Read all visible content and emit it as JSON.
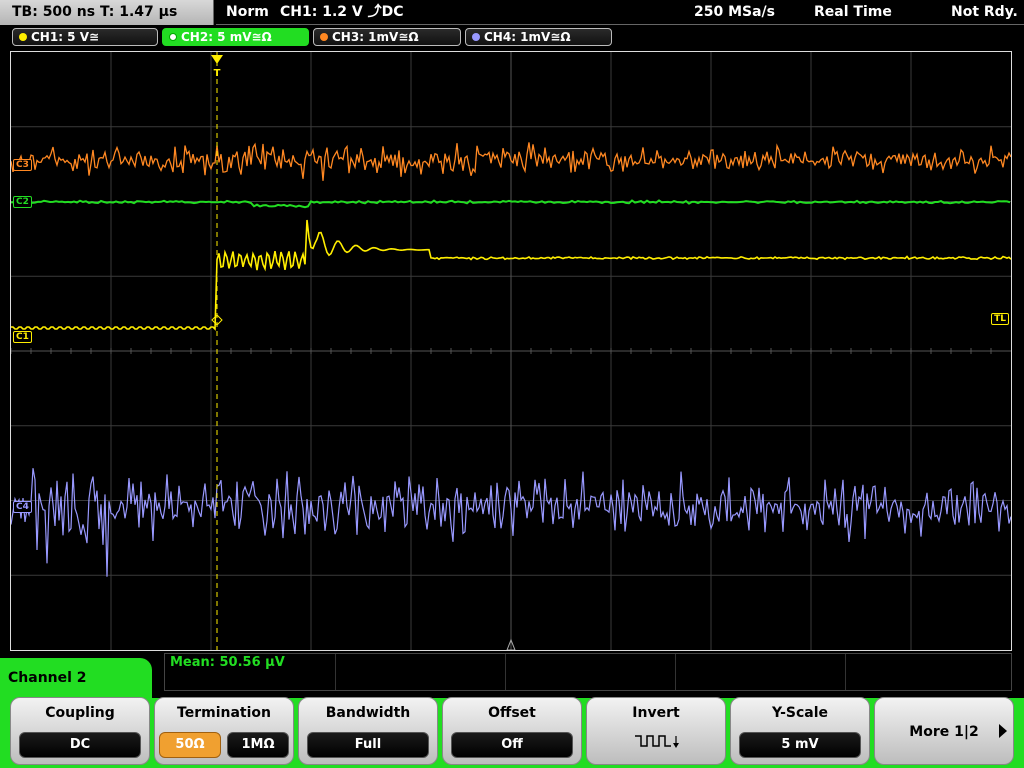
{
  "status_bar": {
    "timebase": "TB: 500 ns   T: 1.47 µs",
    "mode": "Norm",
    "trigger": "CH1: 1.2 V ⤴DC",
    "sample_rate": "250 MSa/s",
    "acq_mode": "Real Time",
    "status": "Not Rdy."
  },
  "channel_tabs": [
    {
      "label": "CH1: 5 V≅",
      "color": "#ffee00"
    },
    {
      "label": "CH2: 5 mV≅Ω",
      "color": "#22dd22",
      "selected": true
    },
    {
      "label": "CH3: 1mV≅Ω",
      "color": "#ff8822"
    },
    {
      "label": "CH4: 1mV≅Ω",
      "color": "#9999ff"
    }
  ],
  "markers": {
    "c1": "C1",
    "c2": "C2",
    "c3": "C3",
    "c4": "C4",
    "trigger_level": "TL",
    "trigger_pos": "T"
  },
  "measurement": {
    "mean": "Mean: 50.56 µV"
  },
  "menu": {
    "channel_label": "Channel 2",
    "coupling": {
      "title": "Coupling",
      "value": "DC"
    },
    "termination": {
      "title": "Termination",
      "options": [
        "50Ω",
        "1MΩ"
      ],
      "selected": 0
    },
    "bandwidth": {
      "title": "Bandwidth",
      "value": "Full"
    },
    "offset": {
      "title": "Offset",
      "value": "Off"
    },
    "invert": {
      "title": "Invert",
      "icon": "invert-square-wave-icon"
    },
    "yscale": {
      "title": "Y-Scale",
      "value": "5 mV"
    },
    "more": {
      "label": "More 1|2"
    }
  },
  "colors": {
    "ch1": "#ffee00",
    "ch2": "#22dd22",
    "ch3": "#ff8822",
    "ch4": "#9999ff",
    "accent": "#22dd22",
    "selected_option": "#f0a030"
  }
}
